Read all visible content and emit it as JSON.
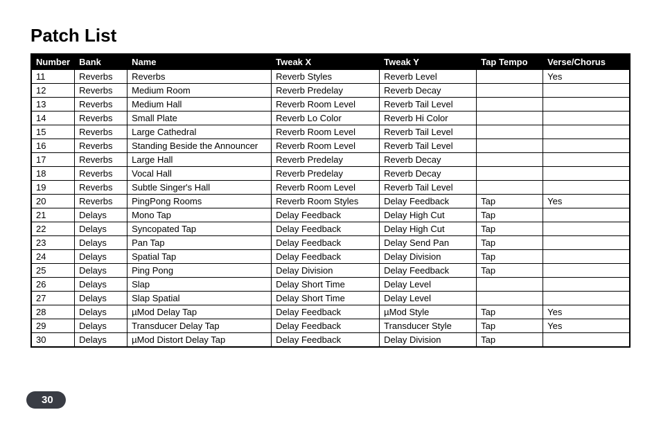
{
  "title": "Patch List",
  "page_number": "30",
  "columns": [
    "Number",
    "Bank",
    "Name",
    "Tweak X",
    "Tweak Y",
    "Tap Tempo",
    "Verse/Chorus"
  ],
  "rows": [
    {
      "num": "11",
      "bank": "Reverbs",
      "name": "Reverbs",
      "tx": "Reverb Styles",
      "ty": "Reverb Level",
      "tap": "",
      "vc": "Yes"
    },
    {
      "num": "12",
      "bank": "Reverbs",
      "name": "Medium Room",
      "tx": "Reverb Predelay",
      "ty": "Reverb Decay",
      "tap": "",
      "vc": ""
    },
    {
      "num": "13",
      "bank": "Reverbs",
      "name": "Medium Hall",
      "tx": "Reverb Room Level",
      "ty": "Reverb Tail Level",
      "tap": "",
      "vc": ""
    },
    {
      "num": "14",
      "bank": "Reverbs",
      "name": "Small Plate",
      "tx": "Reverb Lo Color",
      "ty": "Reverb Hi Color",
      "tap": "",
      "vc": ""
    },
    {
      "num": "15",
      "bank": "Reverbs",
      "name": "Large Cathedral",
      "tx": "Reverb Room Level",
      "ty": "Reverb Tail Level",
      "tap": "",
      "vc": ""
    },
    {
      "num": "16",
      "bank": "Reverbs",
      "name": "Standing Beside the Announcer",
      "tx": "Reverb Room Level",
      "ty": "Reverb Tail Level",
      "tap": "",
      "vc": ""
    },
    {
      "num": "17",
      "bank": "Reverbs",
      "name": "Large Hall",
      "tx": "Reverb Predelay",
      "ty": "Reverb Decay",
      "tap": "",
      "vc": ""
    },
    {
      "num": "18",
      "bank": "Reverbs",
      "name": "Vocal Hall",
      "tx": "Reverb Predelay",
      "ty": "Reverb Decay",
      "tap": "",
      "vc": ""
    },
    {
      "num": "19",
      "bank": "Reverbs",
      "name": "Subtle Singer's Hall",
      "tx": "Reverb Room Level",
      "ty": "Reverb Tail Level",
      "tap": "",
      "vc": ""
    },
    {
      "num": "20",
      "bank": "Reverbs",
      "name": "PingPong Rooms",
      "tx": "Reverb Room Styles",
      "ty": "Delay Feedback",
      "tap": "Tap",
      "vc": "Yes"
    },
    {
      "num": "21",
      "bank": "Delays",
      "name": "Mono Tap",
      "tx": "Delay Feedback",
      "ty": "Delay High Cut",
      "tap": "Tap",
      "vc": ""
    },
    {
      "num": "22",
      "bank": "Delays",
      "name": "Syncopated Tap",
      "tx": "Delay Feedback",
      "ty": "Delay High Cut",
      "tap": "Tap",
      "vc": ""
    },
    {
      "num": "23",
      "bank": "Delays",
      "name": "Pan Tap",
      "tx": "Delay Feedback",
      "ty": "Delay Send Pan",
      "tap": "Tap",
      "vc": ""
    },
    {
      "num": "24",
      "bank": "Delays",
      "name": "Spatial Tap",
      "tx": "Delay Feedback",
      "ty": "Delay Division",
      "tap": "Tap",
      "vc": ""
    },
    {
      "num": "25",
      "bank": "Delays",
      "name": "Ping Pong",
      "tx": "Delay Division",
      "ty": "Delay Feedback",
      "tap": "Tap",
      "vc": ""
    },
    {
      "num": "26",
      "bank": "Delays",
      "name": "Slap",
      "tx": "Delay Short Time",
      "ty": "Delay Level",
      "tap": "",
      "vc": ""
    },
    {
      "num": "27",
      "bank": "Delays",
      "name": "Slap Spatial",
      "tx": "Delay Short Time",
      "ty": "Delay Level",
      "tap": "",
      "vc": ""
    },
    {
      "num": "28",
      "bank": "Delays",
      "name": "µMod Delay Tap",
      "tx": "Delay Feedback",
      "ty": "µMod Style",
      "tap": "Tap",
      "vc": "Yes"
    },
    {
      "num": "29",
      "bank": "Delays",
      "name": "Transducer Delay Tap",
      "tx": "Delay Feedback",
      "ty": "Transducer Style",
      "tap": "Tap",
      "vc": "Yes"
    },
    {
      "num": "30",
      "bank": "Delays",
      "name": "µMod Distort Delay Tap",
      "tx": "Delay Feedback",
      "ty": "Delay Division",
      "tap": "Tap",
      "vc": ""
    }
  ]
}
